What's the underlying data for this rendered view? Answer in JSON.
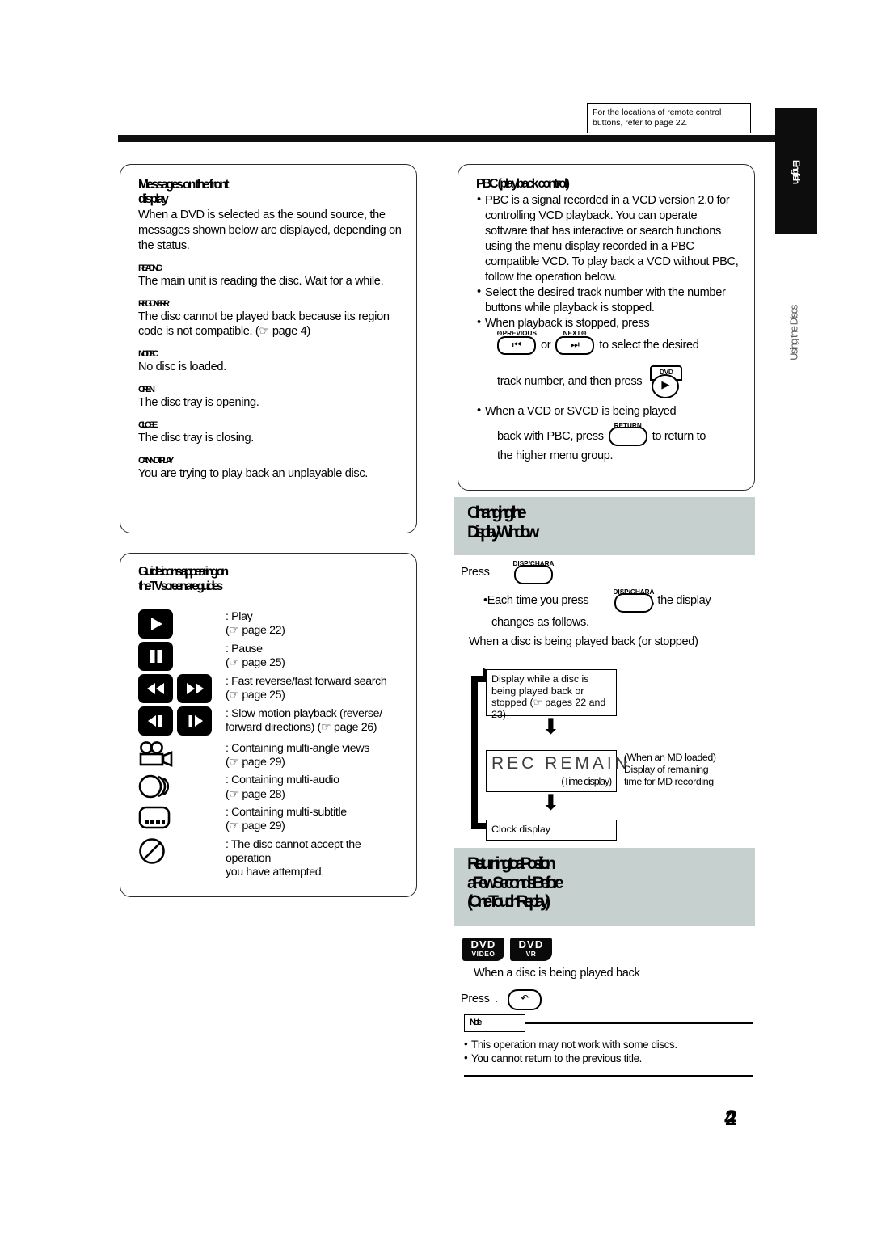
{
  "header": {
    "callout_line1": "For the locations of remote control",
    "callout_line2": "buttons, refer to page 22."
  },
  "side": {
    "language_tab": "English",
    "section_label": "Using the Discs"
  },
  "front_display_panel": {
    "title_line1": "Messages on the front",
    "title_line2": "display",
    "intro": "When a DVD is selected as the sound source, the messages shown below are displayed, depending on the status.",
    "messages": [
      {
        "code": "READING",
        "desc": "The main unit is reading the disc. Wait for a while."
      },
      {
        "code": "REGION ERR",
        "desc": "The disc cannot be played back because its region code is not compatible. (☞ page 4)"
      },
      {
        "code": "NO DISC",
        "desc": "No disc is loaded."
      },
      {
        "code": "OPEN",
        "desc": "The disc tray is opening."
      },
      {
        "code": "CLOSE",
        "desc": "The disc tray is closing."
      },
      {
        "code": "CANNOT PLAY",
        "desc": "You are trying to play back an unplayable disc."
      }
    ]
  },
  "pbc_panel": {
    "title": "PBC (playback control)",
    "bullets": [
      "PBC is a signal recorded in a VCD version 2.0 for controlling VCD playback. You can operate software that has interactive or search functions using the menu display recorded in a PBC compatible VCD. To play back a VCD without PBC, follow the operation below.",
      "Select the desired track number with the number buttons while playback is stopped."
    ],
    "bullet3_prefix": "When playback is stopped, press",
    "row1_or": "or",
    "row1_tail": "to select the desired",
    "row2_text": "track number, and then press",
    "bullet4_line1": "When a VCD or SVCD is being played",
    "bullet4_line2_a": "back with PBC, press",
    "bullet4_line2_b": "to return to",
    "bullet4_line3": "the higher menu group.",
    "buttons": {
      "previous_label": "PREVIOUS",
      "previous_glyph": "⏮",
      "previous_sign": "⊖",
      "next_label": "NEXT",
      "next_glyph": "⏭",
      "next_sign": "⊕",
      "dvd_label": "DVD",
      "dvd_glyph": "▶",
      "return_label": "RETURN",
      "return_glyph": "↶"
    }
  },
  "guide_panel": {
    "title_line1": "Guide icons appearing on",
    "title_line2": "the TV screen are guides",
    "rows": [
      {
        "icons": [
          "play"
        ],
        "text_line1": ": Play",
        "text_line2": "(☞ page 22)"
      },
      {
        "icons": [
          "pause"
        ],
        "text_line1": ": Pause",
        "text_line2": "(☞ page 25)"
      },
      {
        "icons": [
          "rew",
          "ff"
        ],
        "text_line1": ": Fast reverse/fast forward search",
        "text_line2": "(☞ page 25)"
      },
      {
        "icons": [
          "slow-rev",
          "slow-fwd"
        ],
        "text_line1": ": Slow motion playback (reverse/",
        "text_line2": "forward directions) (☞ page 26)"
      },
      {
        "icons": [
          "camera"
        ],
        "text_line1": ": Containing multi-angle views",
        "text_line2": "(☞ page 29)"
      },
      {
        "icons": [
          "audio"
        ],
        "text_line1": ": Containing multi-audio",
        "text_line2": "(☞ page 28)"
      },
      {
        "icons": [
          "subtitle"
        ],
        "text_line1": ": Containing multi-subtitle",
        "text_line2": "(☞ page 29)"
      },
      {
        "icons": [
          "prohibited"
        ],
        "text_line1": ": The disc cannot accept the operation",
        "text_line2": "you have attempted."
      }
    ]
  },
  "display_window_section": {
    "heading_line1": "Changing the",
    "heading_line2": "Display Window",
    "press_label": "Press",
    "button_label": "DISP/CHARA",
    "sub_a": "•Each time you press",
    "sub_b": ", the display",
    "sub_c": "changes as follows.",
    "condition": "When a disc is being played back (or stopped)",
    "flow": [
      {
        "text": "Display while a disc is being played back or stopped (☞ pages 22 and 23)"
      },
      {
        "text": "REC REMAIN",
        "sub": "(Time display)",
        "note_line1": "(When an MD loaded)",
        "note_line2": "Display of remaining",
        "note_line3": "time for MD recording"
      },
      {
        "text": "Clock display"
      }
    ]
  },
  "return_section": {
    "heading_line1": "Returning to a Position",
    "heading_line2": "a Few Seconds Before",
    "heading_line3": "(One Touch Replay)",
    "badges": [
      {
        "top": "DVD",
        "bottom": "VIDEO"
      },
      {
        "top": "DVD",
        "bottom": "VR"
      }
    ],
    "condition": "When a disc is being played back",
    "press_label": "Press",
    "press_dot": ".",
    "replay_glyph": "↶",
    "note_title": "Note",
    "notes": [
      "This operation may not work with some discs.",
      "You cannot return to the previous title."
    ]
  },
  "footer": {
    "page_number": "24"
  }
}
